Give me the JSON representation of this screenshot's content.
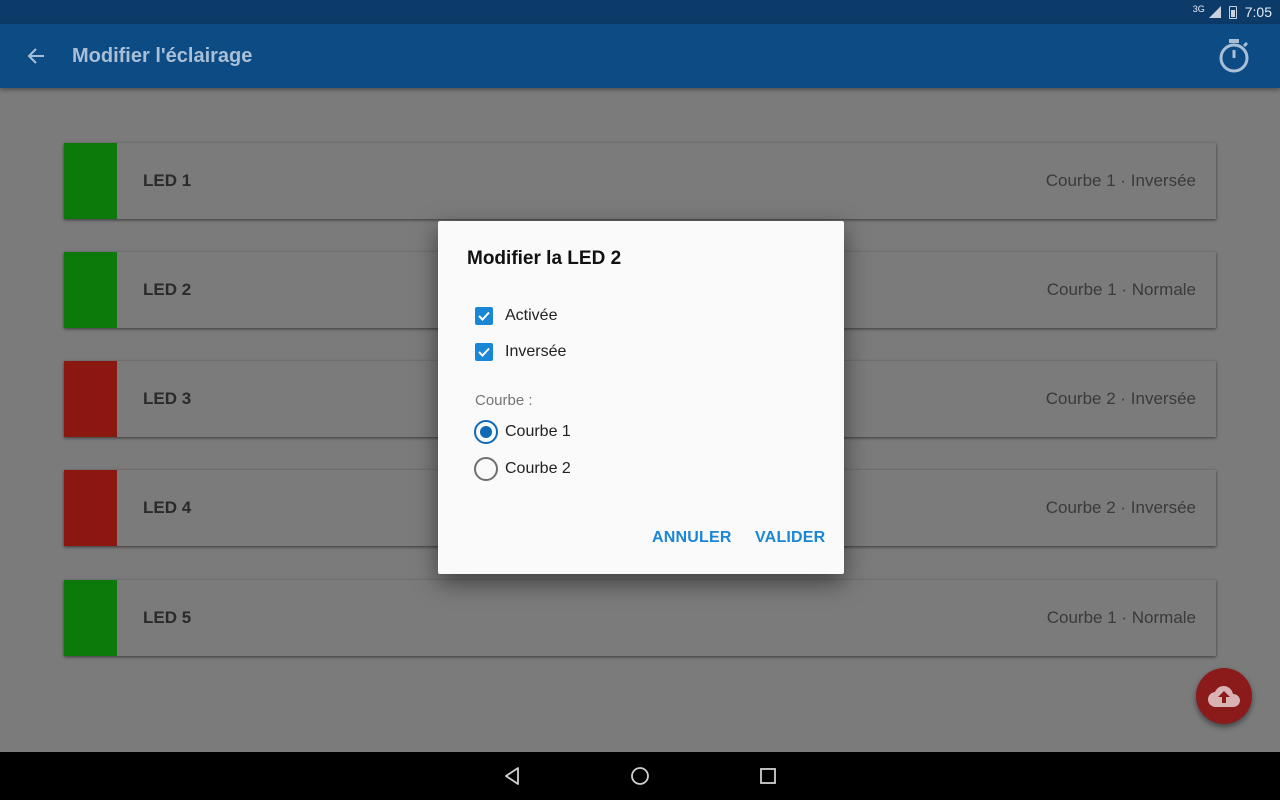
{
  "status_bar": {
    "signal": "3G",
    "time": "7:05"
  },
  "app_bar": {
    "title": "Modifier l'éclairage",
    "back_icon": "arrow-back-icon",
    "timer_icon": "timer-icon"
  },
  "leds": [
    {
      "name": "LED 1",
      "info": "Courbe 1 · Inversée",
      "color": "#0b7a0b"
    },
    {
      "name": "LED 2",
      "info": "Courbe 1 · Normale",
      "color": "#0b7a0b"
    },
    {
      "name": "LED 3",
      "info": "Courbe 2 · Inversée",
      "color": "#8a1710"
    },
    {
      "name": "LED 4",
      "info": "Courbe 2 · Inversée",
      "color": "#8a1710"
    },
    {
      "name": "LED 5",
      "info": "Courbe 1 · Normale",
      "color": "#0b7a0b"
    }
  ],
  "fab": {
    "icon": "cloud-upload-icon",
    "color": "#8b1a1a"
  },
  "dialog": {
    "title": "Modifier la LED 2",
    "options": [
      {
        "label": "Activée",
        "checked": true
      },
      {
        "label": "Inversée",
        "checked": true
      }
    ],
    "curve_label": "Courbe :",
    "curves": [
      {
        "label": "Courbe 1",
        "selected": true
      },
      {
        "label": "Courbe 2",
        "selected": false
      }
    ],
    "cancel_label": "ANNULER",
    "confirm_label": "VALIDER"
  },
  "nav": {
    "back_icon": "nav-back-icon",
    "home_icon": "nav-home-icon",
    "recents_icon": "nav-recents-icon"
  },
  "colors": {
    "accent": "#1a87d6",
    "app_bar": "#0d4b84",
    "status_bar": "#0c3a69"
  }
}
